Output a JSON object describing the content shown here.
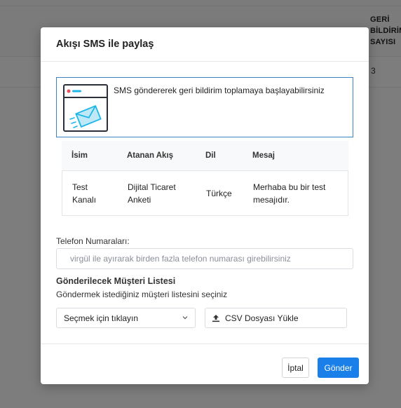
{
  "background": {
    "column_title_lines": [
      "GERİ",
      "BİLDİRİM",
      "SAYISI"
    ],
    "cell_value": "3"
  },
  "modal": {
    "title": "Akışı SMS ile paylaş",
    "info_text": "SMS göndererek geri bildirim toplamaya başlayabilirsiniz",
    "table": {
      "headers": [
        "İsim",
        "Atanan Akış",
        "Dil",
        "Mesaj"
      ],
      "row": [
        "Test Kanalı",
        "Dijital Ticaret Anketi",
        "Türkçe",
        "Merhaba bu bir test mesajıdır."
      ]
    },
    "phone": {
      "label": "Telefon Numaraları:",
      "placeholder": "virgül ile ayırarak birden fazla telefon numarası girebilirsiniz",
      "value": ""
    },
    "customer_list": {
      "title": "Gönderilecek Müşteri Listesi",
      "subtitle": "Göndermek istediğiniz müşteri listesini seçiniz",
      "select_placeholder": "Seçmek için tıklayın",
      "csv_label": "CSV Dosyası Yükle"
    },
    "footer": {
      "cancel_label": "İptal",
      "send_label": "Gönder"
    }
  },
  "colors": {
    "accent": "#1a7fe8",
    "info_border": "#3b82c4",
    "envelope": "#1fb6e8"
  },
  "icons": [
    "envelope-icon",
    "chevron-down-icon",
    "upload-icon"
  ]
}
